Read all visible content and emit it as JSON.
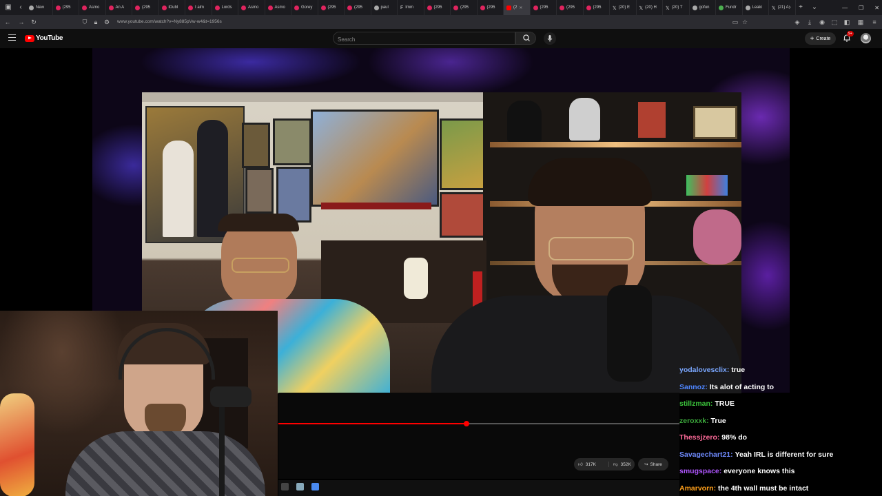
{
  "browser": {
    "tabs": [
      {
        "label": "New",
        "icon": "blank"
      },
      {
        "label": "(295",
        "icon": "rumble"
      },
      {
        "label": "Asmo",
        "icon": "rumble"
      },
      {
        "label": "An A",
        "icon": "rumble"
      },
      {
        "label": "(295",
        "icon": "rumble"
      },
      {
        "label": "iDubl",
        "icon": "rumble"
      },
      {
        "label": "I alm",
        "icon": "rumble"
      },
      {
        "label": "Lords",
        "icon": "rumble"
      },
      {
        "label": "Asmo",
        "icon": "rumble"
      },
      {
        "label": "Asmo",
        "icon": "rumble"
      },
      {
        "label": "Gorey",
        "icon": "rumble"
      },
      {
        "label": "(295",
        "icon": "rumble"
      },
      {
        "label": "(295",
        "icon": "rumble"
      },
      {
        "label": "paul",
        "icon": "globe"
      },
      {
        "label": "Imm",
        "icon": "f"
      },
      {
        "label": "(295",
        "icon": "rumble"
      },
      {
        "label": "(295",
        "icon": "rumble"
      },
      {
        "label": "(295",
        "icon": "rumble"
      },
      {
        "label": "(2",
        "icon": "youtube",
        "active": true
      },
      {
        "label": "(295",
        "icon": "rumble"
      },
      {
        "label": "(295",
        "icon": "rumble"
      },
      {
        "label": "(295",
        "icon": "rumble"
      },
      {
        "label": "(20) E",
        "icon": "x"
      },
      {
        "label": "(20) H",
        "icon": "x"
      },
      {
        "label": "(20) T",
        "icon": "x"
      },
      {
        "label": "gofun",
        "icon": "globe"
      },
      {
        "label": "Fundr",
        "icon": "w"
      },
      {
        "label": "Leaki",
        "icon": "globe"
      },
      {
        "label": "(21) A",
        "icon": "x"
      }
    ],
    "new_tab": "+",
    "tab_menu": "⌄",
    "window_controls": [
      "—",
      "❐",
      "✕"
    ],
    "url": "www.youtube.com/watch?v=Ny885pVw-w4&t=1956s"
  },
  "youtube": {
    "logo_text": "YouTube",
    "search_placeholder": "Search",
    "create_label": "Create",
    "notification_count": "9+"
  },
  "player": {
    "progress_fraction": 0.469,
    "like_count": "317K",
    "dislike_count": "352K",
    "share_label": "Share"
  },
  "chat": {
    "messages": [
      {
        "user": "yodalovesclix:",
        "text": "true",
        "color": "#7aa7ff"
      },
      {
        "user": "Sannoz:",
        "text": "Its alot of acting to",
        "color": "#4f86ff"
      },
      {
        "user": "stillzman:",
        "text": "TRUE",
        "color": "#3cc43c"
      },
      {
        "user": "zeroxxk:",
        "text": "True",
        "color": "#3ca83c"
      },
      {
        "user": "Thessjzero:",
        "text": "98% do",
        "color": "#ff6b9a"
      },
      {
        "user": "Savagechart21:",
        "text": "Yeah IRL is different for sure",
        "color": "#6f8bff"
      },
      {
        "user": "smugspace:",
        "text": "everyone knows this",
        "color": "#b056ff"
      },
      {
        "user": "Amarvorn:",
        "text": "the 4th wall must be intact",
        "color": "#ff9f1a"
      }
    ]
  }
}
